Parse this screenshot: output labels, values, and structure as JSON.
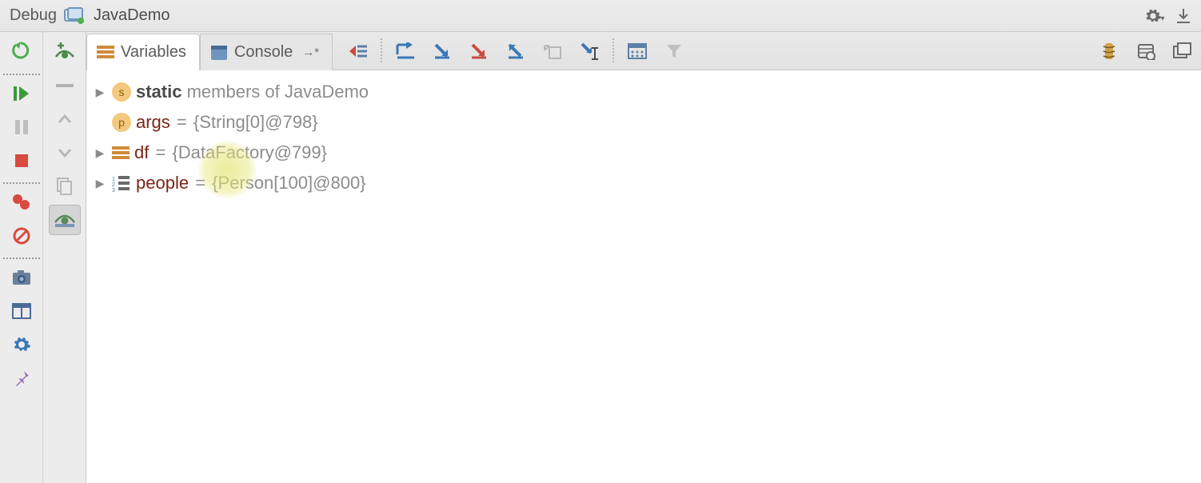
{
  "header": {
    "panel_label": "Debug",
    "config_name": "JavaDemo"
  },
  "tabs": {
    "variables": "Variables",
    "console": "Console"
  },
  "variables": [
    {
      "expandable": true,
      "kind": "static",
      "prefix_kw": "static",
      "members_text": " members of JavaDemo"
    },
    {
      "expandable": false,
      "kind": "param",
      "name": "args",
      "value": "{String[0]@798}"
    },
    {
      "expandable": true,
      "kind": "object",
      "name": "df",
      "value": "{DataFactory@799}"
    },
    {
      "expandable": true,
      "kind": "array",
      "name": "people",
      "value": "{Person[100]@800}"
    }
  ]
}
